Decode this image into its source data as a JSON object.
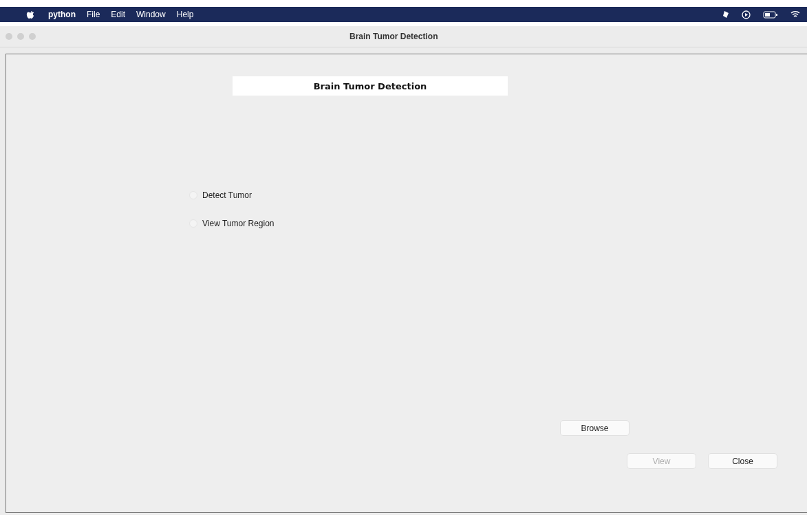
{
  "menu_bar": {
    "app": "python",
    "items": [
      "File",
      "Edit",
      "Window",
      "Help"
    ]
  },
  "window": {
    "title": "Brain Tumor Detection"
  },
  "heading": "Brain Tumor Detection",
  "options": [
    {
      "label": "Detect Tumor",
      "selected": false
    },
    {
      "label": "View Tumor Region",
      "selected": false
    }
  ],
  "browse_button": {
    "label": "Browse",
    "disabled": false
  },
  "buttons": [
    {
      "label": "View",
      "disabled": true
    },
    {
      "label": "Close",
      "disabled": false
    }
  ]
}
